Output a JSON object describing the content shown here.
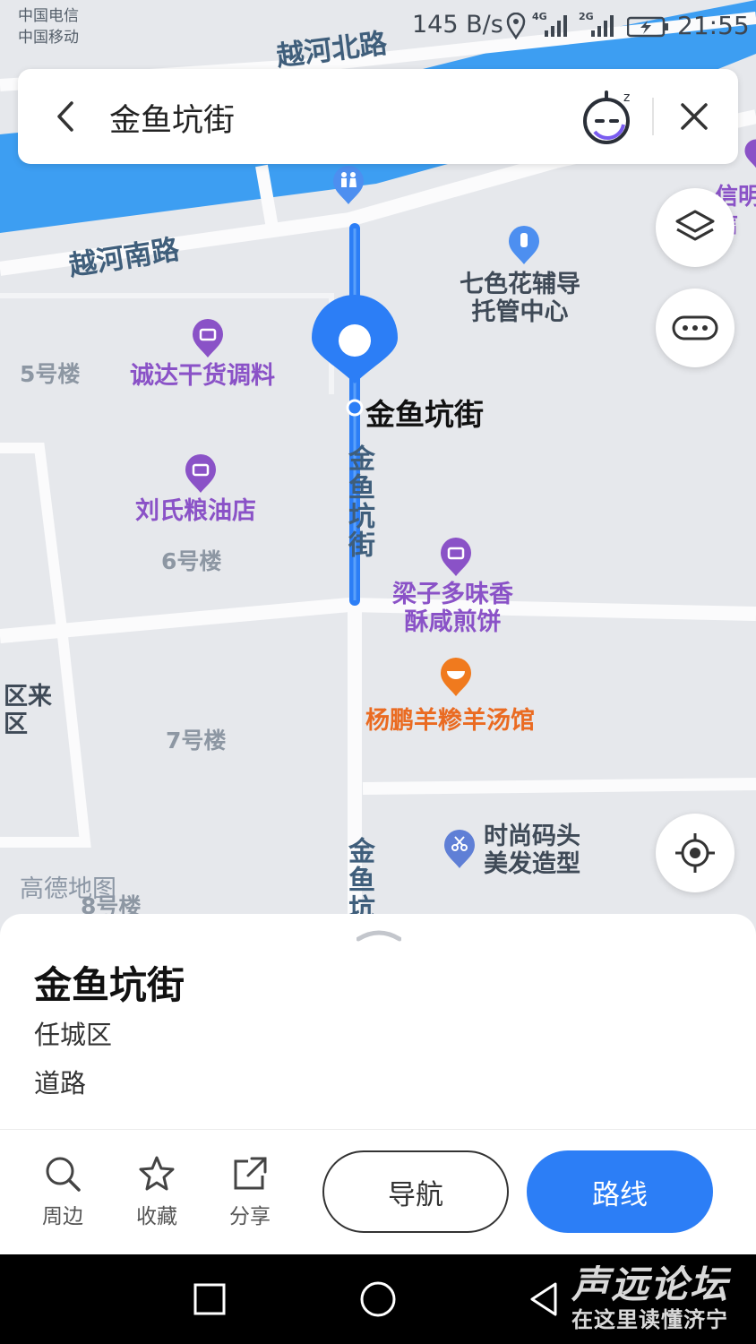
{
  "status_bar": {
    "carrier_1": "中国电信",
    "carrier_2": "中国移动",
    "network_speed": "145 B/s",
    "signal_1_type": "4G",
    "signal_2_type": "2G",
    "time": "21:55"
  },
  "search": {
    "query": "金鱼坑街"
  },
  "map": {
    "road_labels": {
      "yuehe_north": "越河北路",
      "yuehe_south": "越河南路",
      "jinyukeng_1": "金鱼坑街",
      "jinyukeng_2": "金鱼坑"
    },
    "selected_road_label": "金鱼坑街",
    "buildings": {
      "b5": "5号楼",
      "b6": "6号楼",
      "b7": "7号楼",
      "b8": "8号楼"
    },
    "pois": {
      "chengda": "诚达干货调料",
      "liushi": "刘氏粮油店",
      "qisehua_line1": "七色花辅导",
      "qisehua_line2": "托管中心",
      "liangzi_line1": "梁子多味香",
      "liangzi_line2": "酥咸煎饼",
      "yangpeng": "杨鹏羊糁羊汤馆",
      "shishang_line1": "时尚码头",
      "shishang_line2": "美发造型",
      "edge_right_1": "信明",
      "edge_right_2": "信",
      "edge_left_1": "区来",
      "edge_left_2": "区"
    },
    "watermark_logo": "高德地图"
  },
  "place": {
    "name": "金鱼坑街",
    "district": "任城区",
    "category": "道路"
  },
  "actions": {
    "nearby": "周边",
    "favorite": "收藏",
    "share": "分享",
    "navigate": "导航",
    "route": "路线"
  },
  "forum_watermark": {
    "line1": "声远论坛",
    "line2": "在这里读懂济宁"
  },
  "colors": {
    "route_blue": "#2c7ef6",
    "river_blue": "#3d9ef2",
    "poi_purple": "#8a52c7",
    "poi_orange": "#f07a1e"
  }
}
